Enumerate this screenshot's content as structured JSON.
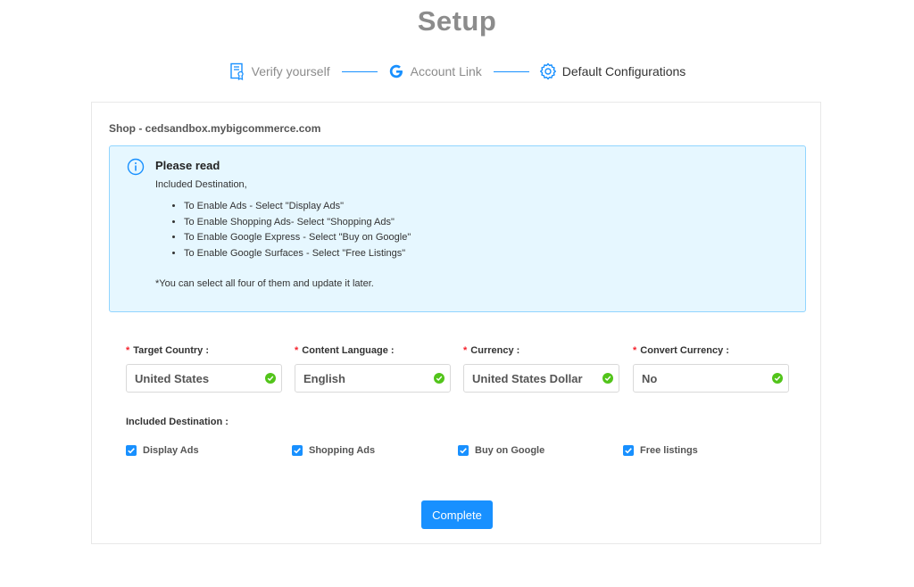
{
  "page": {
    "title": "Setup"
  },
  "steps": [
    {
      "label": "Verify yourself",
      "icon": "verify-document-icon",
      "status": "done"
    },
    {
      "label": "Account Link",
      "icon": "google-g-icon",
      "status": "done"
    },
    {
      "label": "Default Configurations",
      "icon": "gear-icon",
      "status": "current"
    }
  ],
  "shop": {
    "label": "Shop - cedsandbox.mybigcommerce.com"
  },
  "notice": {
    "title": "Please read",
    "intro": "Included Destination,",
    "items": [
      "To Enable Ads - Select \"Display Ads\"",
      "To Enable Shopping Ads- Select \"Shopping Ads\"",
      "To Enable Google Express - Select \"Buy on Google\"",
      "To Enable Google Surfaces - Select \"Free Listings\""
    ],
    "footer": "*You can select all four of them and update it later."
  },
  "fields": [
    {
      "label": "Target Country",
      "value": "United States"
    },
    {
      "label": "Content Language",
      "value": "English"
    },
    {
      "label": "Currency",
      "value": "United States Dollar"
    },
    {
      "label": "Convert Currency",
      "value": "No"
    }
  ],
  "destinations": {
    "label": "Included Destination",
    "options": [
      {
        "label": "Display Ads",
        "checked": true
      },
      {
        "label": "Shopping Ads",
        "checked": true
      },
      {
        "label": "Buy on Google",
        "checked": true
      },
      {
        "label": "Free listings",
        "checked": true
      }
    ]
  },
  "actions": {
    "complete_label": "Complete"
  },
  "colors": {
    "primary": "#1890ff",
    "success": "#52c41a",
    "required": "#f5222d",
    "notice_bg": "#e6f7ff"
  }
}
